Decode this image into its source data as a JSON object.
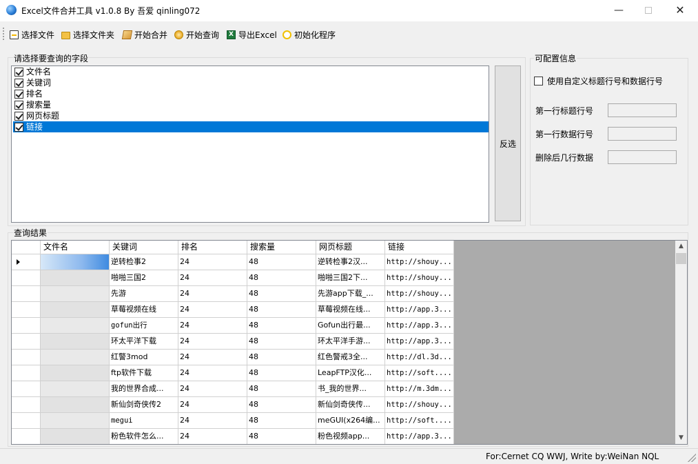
{
  "window": {
    "title": "Excel文件合并工具 v1.0.8 By 吾爱 qinling072",
    "minimize": "—",
    "close": "✕"
  },
  "toolbar": {
    "select_file": "选择文件",
    "select_folder": "选择文件夹",
    "start_merge": "开始合并",
    "start_query": "开始查询",
    "export_excel": "导出Excel",
    "init_program": "初始化程序",
    "excel_icon_letter": "X"
  },
  "fields_group": {
    "label": "请选择要查询的字段",
    "items": [
      {
        "label": "文件名",
        "checked": true
      },
      {
        "label": "关键词",
        "checked": true
      },
      {
        "label": "排名",
        "checked": true
      },
      {
        "label": "搜索量",
        "checked": true
      },
      {
        "label": "网页标题",
        "checked": true
      },
      {
        "label": "链接",
        "checked": true
      }
    ],
    "invert_button": "反选"
  },
  "config_group": {
    "label": "可配置信息",
    "custom_rows_label": "使用自定义标题行号和数据行号",
    "first_title_row_label": "第一行标题行号",
    "first_data_row_label": "第一行数据行号",
    "delete_last_rows_label": "删除后几行数据",
    "first_title_row_value": "",
    "first_data_row_value": "",
    "delete_last_rows_value": ""
  },
  "results": {
    "label": "查询结果",
    "columns": [
      "文件名",
      "关键词",
      "排名",
      "搜索量",
      "网页标题",
      "链接"
    ],
    "rows": [
      {
        "filename": "",
        "keyword": "逆转检事2",
        "rank": "24",
        "volume": "48",
        "title": "逆转检事2汉...",
        "link": "http://shouy..."
      },
      {
        "filename": "",
        "keyword": "啪啪三国2",
        "rank": "24",
        "volume": "48",
        "title": "啪啪三国2下...",
        "link": "http://shouy..."
      },
      {
        "filename": "",
        "keyword": "先游",
        "rank": "24",
        "volume": "48",
        "title": "先游app下载_...",
        "link": "http://shouy..."
      },
      {
        "filename": "",
        "keyword": "草莓视频在线",
        "rank": "24",
        "volume": "48",
        "title": "草莓视频在线...",
        "link": "http://app.3..."
      },
      {
        "filename": "",
        "keyword": "gofun出行",
        "rank": "24",
        "volume": "48",
        "title": "Gofun出行最...",
        "link": "http://app.3..."
      },
      {
        "filename": "",
        "keyword": "环太平洋下载",
        "rank": "24",
        "volume": "48",
        "title": "环太平洋手游...",
        "link": "http://app.3..."
      },
      {
        "filename": "",
        "keyword": "红警3mod",
        "rank": "24",
        "volume": "48",
        "title": "红色警戒3全...",
        "link": "http://dl.3d..."
      },
      {
        "filename": "",
        "keyword": "ftp软件下载",
        "rank": "24",
        "volume": "48",
        "title": "LeapFTP汉化...",
        "link": "http://soft...."
      },
      {
        "filename": "",
        "keyword": "我的世界合成...",
        "rank": "24",
        "volume": "48",
        "title": "书_我的世界...",
        "link": "http://m.3dm..."
      },
      {
        "filename": "",
        "keyword": "新仙剑奇侠传2",
        "rank": "24",
        "volume": "48",
        "title": "新仙剑奇侠传...",
        "link": "http://shouy..."
      },
      {
        "filename": "",
        "keyword": "megui",
        "rank": "24",
        "volume": "48",
        "title": "meGUI(x264编...",
        "link": "http://soft...."
      },
      {
        "filename": "",
        "keyword": "粉色软件怎么...",
        "rank": "24",
        "volume": "48",
        "title": "粉色视频app...",
        "link": "http://app.3..."
      }
    ]
  },
  "statusbar": {
    "text": "For:Cernet CQ WWJ, Write by:WeiNan NQL"
  }
}
